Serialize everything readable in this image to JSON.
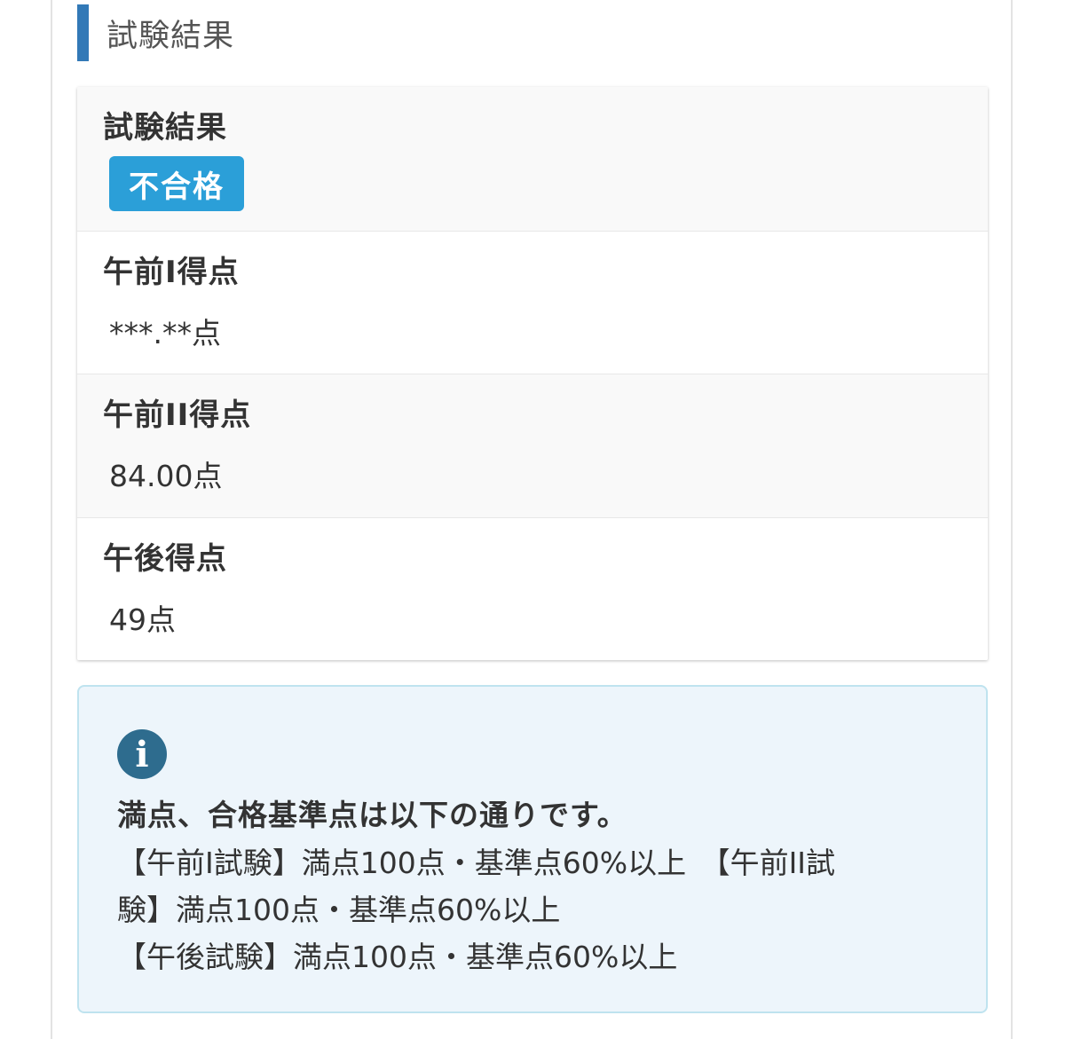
{
  "section": {
    "heading": "試験結果"
  },
  "result": {
    "label": "試験結果",
    "status_badge": "不合格",
    "badge_color": "#2b9fd8"
  },
  "scores": [
    {
      "label": "午前I得点",
      "value": "***.**点"
    },
    {
      "label": "午前II得点",
      "value": "84.00点"
    },
    {
      "label": "午後得点",
      "value": "49点"
    }
  ],
  "info": {
    "icon": "info-icon",
    "title": "満点、合格基準点は以下の通りです。",
    "lines": [
      "【午前I試験】満点100点・基準点60%以上　【午前II試",
      "験】満点100点・基準点60%以上",
      "【午後試験】満点100点・基準点60%以上"
    ]
  },
  "colors": {
    "accent_bar": "#3279b7",
    "info_background": "#edf5fb",
    "info_border": "#bfe3ef",
    "info_icon": "#2e6c8e"
  }
}
